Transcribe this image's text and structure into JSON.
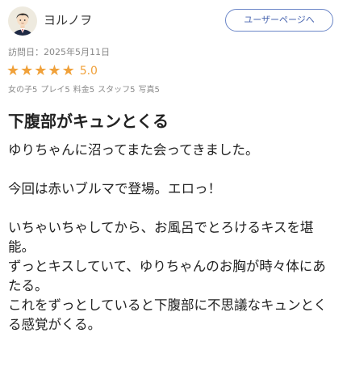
{
  "user": {
    "name": "ヨルノヲ",
    "profile_button": "ユーザーページへ"
  },
  "review": {
    "visit_date": "訪問日：2025年5月11日",
    "rating": {
      "stars": 5,
      "score": "5.0"
    },
    "subscores": [
      "女の子5",
      "プレイ5",
      "料金5",
      "スタッフ5",
      "写真5"
    ],
    "title": "下腹部がキュンとくる",
    "paragraphs": [
      "ゆりちゃんに沼ってまた会ってきました。",
      "",
      "今回は赤いブルマで登場。エロっ！",
      "",
      "いちゃいちゃしてから、お風呂でとろけるキスを堪能。",
      "ずっとキスしていて、ゆりちゃんのお胸が時々体にあたる。",
      "これをずっとしていると下腹部に不思議なキュンとくる感覚がくる。"
    ]
  },
  "colors": {
    "star": "#f0a13a",
    "button_border": "#6b86c7",
    "button_text": "#4a66b0"
  },
  "icons": {
    "avatar": "man-avatar-icon",
    "star": "star-icon"
  }
}
